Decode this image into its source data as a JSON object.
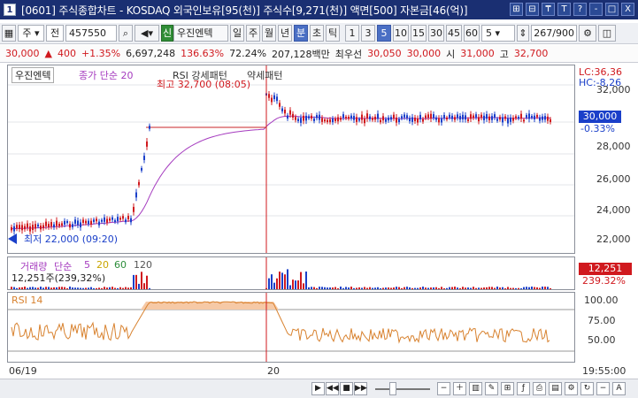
{
  "window": {
    "title": "[0601] 주식종합차트 - KOSDAQ 외국인보유[95(천)] 주식수[9,271(천)] 액면[500] 자본금[46(억)]",
    "app_icon": "1",
    "buttons": [
      "⊞",
      "⊟",
      "₸",
      "T",
      "?",
      "-",
      "□",
      "X"
    ]
  },
  "toolbar": {
    "market": "주",
    "market2": "전",
    "code": "457550",
    "stock_badge": "신",
    "stock_name": "우진엔텍",
    "periods": [
      "일",
      "주",
      "월",
      "년",
      "분",
      "초",
      "틱"
    ],
    "active_period": "분",
    "intervals": [
      "1",
      "3",
      "5",
      "10",
      "15",
      "30",
      "45",
      "60"
    ],
    "active_interval": "5",
    "count_value": "5",
    "range": "267",
    "range_total": "/900"
  },
  "quote": {
    "price": "30,000",
    "change": "400",
    "change_pct": "+1.35%",
    "volume": "6,697,248",
    "vol_ratio": "136.63%",
    "turnover": "72.24%",
    "amount": "207,128백만",
    "best_seller_label": "최우선",
    "best_seller": "30,050",
    "best_buyer": "30,000",
    "open_label": "시",
    "open": "31,000",
    "high_label": "고",
    "high": "32,700",
    "low_label": "저",
    "low": "29,000"
  },
  "chart": {
    "price_legend": [
      "우진엔텍",
      "종가 단순 20"
    ],
    "pattern_labels": [
      "RSI 강세패턴",
      "약세패턴"
    ],
    "high_annotation": "최고 32,700 (08:05)",
    "low_annotation": "최저 22,000 (09:20)",
    "price_axis": [
      "32,000",
      "30,000",
      "28,000",
      "26,000",
      "24,000",
      "22,000"
    ],
    "lc": "LC:36,36",
    "hc": "HC:-8,26",
    "current_price": "30,000",
    "current_pct": "-0.33%",
    "volume_legend": [
      "거래량",
      "단순",
      "5",
      "20",
      "60",
      "120"
    ],
    "volume_value": "12,251주(239,32%)",
    "volume_box": "12,251",
    "volume_box_pct": "239.32%",
    "rsi_legend": "RSI 14",
    "rsi_axis": [
      "100.00",
      "75.00",
      "50.00"
    ],
    "x_labels": [
      "06/19",
      "20"
    ],
    "time_label": "19:55:00"
  },
  "colors": {
    "up": "#d0191e",
    "down": "#1a3fc9",
    "ma20": "#a53bbf",
    "rsi": "#d8822f",
    "title": "#1a2f72"
  }
}
